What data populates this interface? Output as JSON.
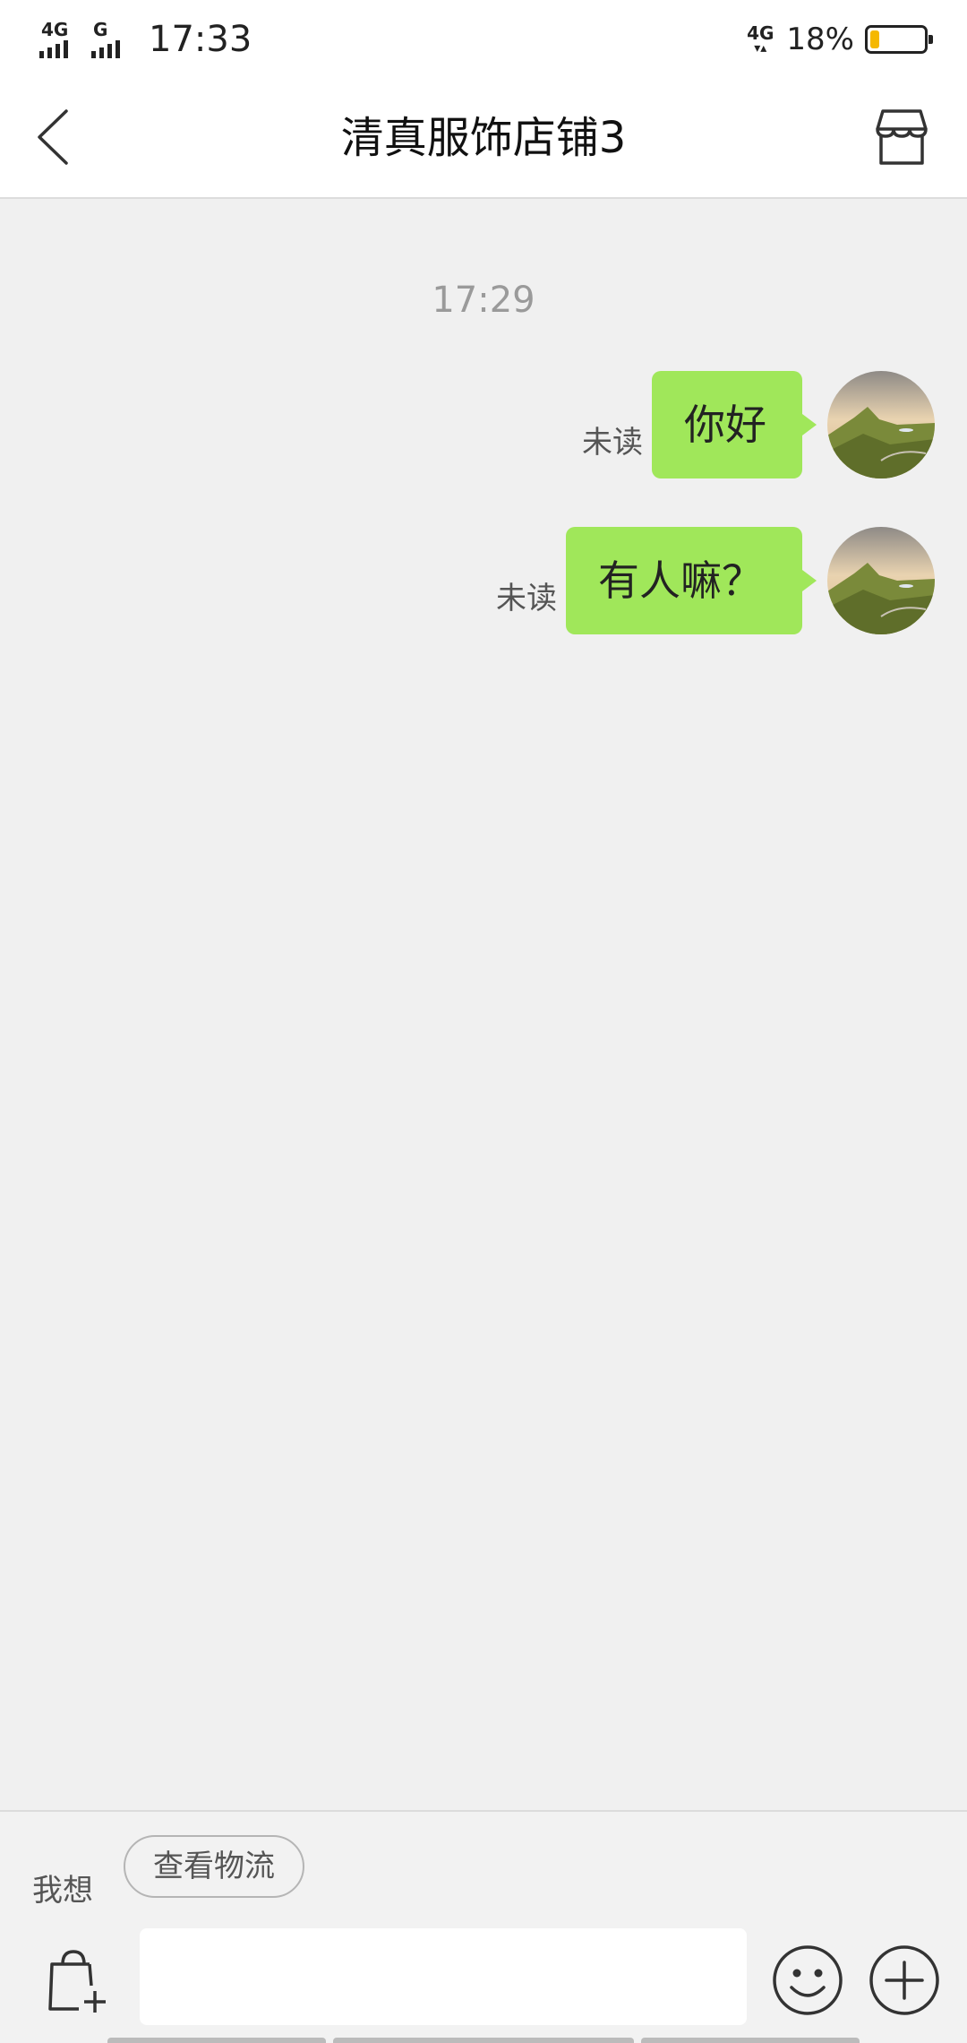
{
  "status_bar": {
    "network_1": "4G",
    "network_2": "G",
    "time": "17:33",
    "network_right": "4G",
    "battery_percent": "18%",
    "battery_level": 0.18,
    "battery_color": "#f5b800"
  },
  "header": {
    "back_icon": "chevron-left-icon",
    "title": "清真服饰店铺3",
    "shop_icon": "store-icon"
  },
  "chat": {
    "timestamp": "17:29",
    "messages": [
      {
        "text": "你好",
        "status": "未读"
      },
      {
        "text": "有人嘛？",
        "status": "未读"
      }
    ],
    "bubble_color": "#a0e75a"
  },
  "bottom": {
    "want_label": "我想",
    "quick_reply": "查看物流",
    "input_value": "",
    "bag_icon": "shopping-bag-add-icon",
    "emoji_icon": "smiley-icon",
    "plus_icon": "plus-circle-icon"
  }
}
